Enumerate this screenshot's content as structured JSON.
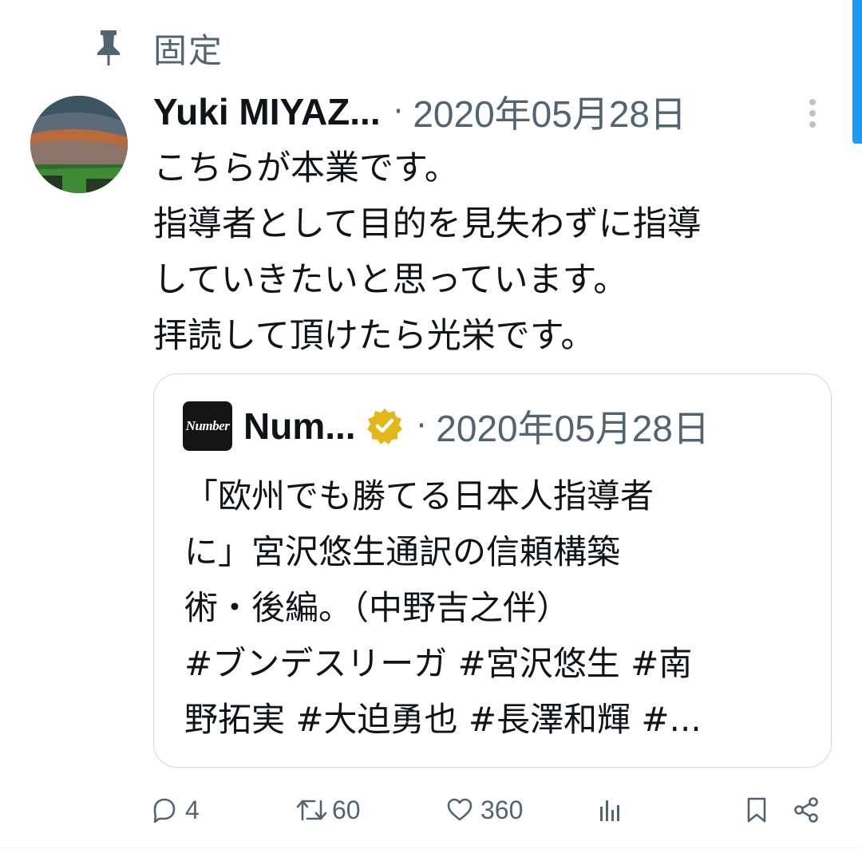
{
  "pinned": {
    "label": "固定",
    "icon": "pin-icon"
  },
  "tweet": {
    "author_name": "Yuki MIYAZ...",
    "separator": "·",
    "date": "2020年05月28日",
    "text_lines": [
      "こちらが本業です。",
      "指導者として目的を見失わずに指導",
      "していきたいと思っています。",
      "拝読して頂けたら光栄です。"
    ]
  },
  "quote": {
    "logo_text": "Number",
    "author_name": "Num...",
    "verified_badge": "gold-verified-icon",
    "separator": "·",
    "date": "2020年05月28日",
    "text_lines": [
      "「欧州でも勝てる日本人指導者",
      "に」宮沢悠生通訳の信頼構築",
      "術・後編。（中野吉之伴）",
      "#ブンデスリーガ #宮沢悠生 #南",
      "野拓実 #大迫勇也 #長澤和輝 #..."
    ]
  },
  "actions": {
    "replies": "4",
    "retweets": "60",
    "likes": "360"
  },
  "colors": {
    "text": "#0f1419",
    "muted": "#536471",
    "border": "#cfd9de",
    "accent": "#1d9bf0",
    "gold_badge": "#e2b719"
  }
}
